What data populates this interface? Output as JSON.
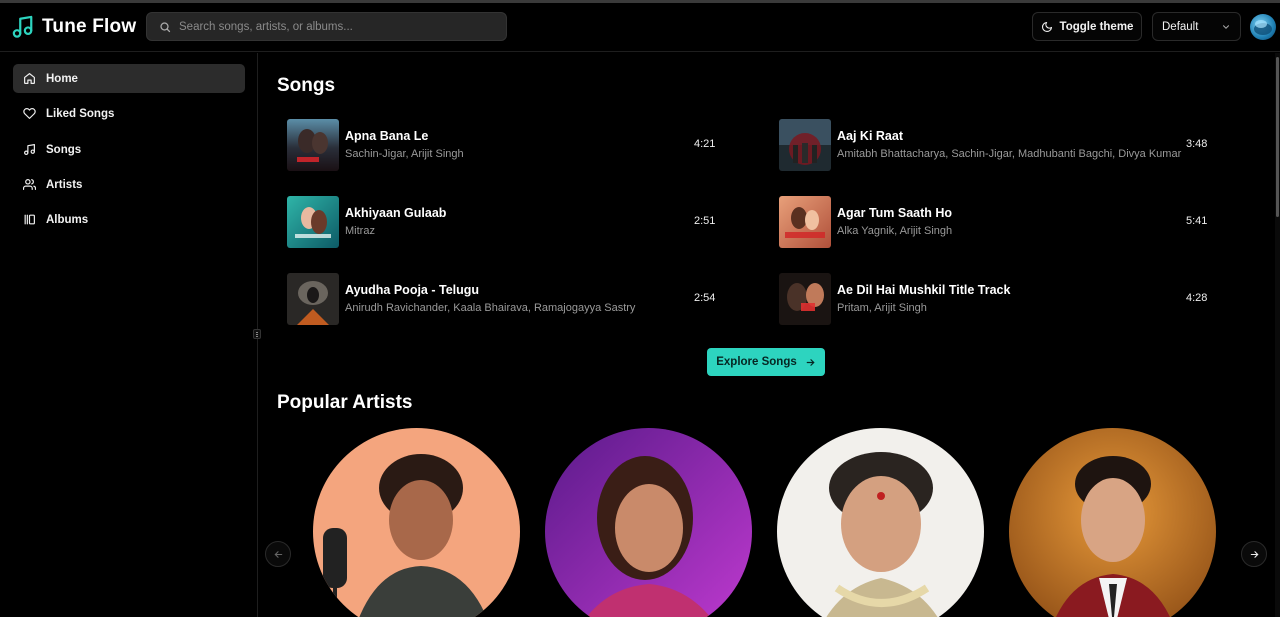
{
  "app": {
    "name": "Tune Flow",
    "accent": "#2dd4bf"
  },
  "header": {
    "search_placeholder": "Search songs, artists, or albums...",
    "toggle_theme_label": "Toggle theme",
    "theme_select_value": "Default"
  },
  "sidebar": {
    "items": [
      {
        "label": "Home",
        "icon": "home-icon",
        "active": true
      },
      {
        "label": "Liked Songs",
        "icon": "heart-icon",
        "active": false
      },
      {
        "label": "Songs",
        "icon": "music-note-icon",
        "active": false
      },
      {
        "label": "Artists",
        "icon": "users-icon",
        "active": false
      },
      {
        "label": "Albums",
        "icon": "library-icon",
        "active": false
      }
    ]
  },
  "songs_section": {
    "title": "Songs",
    "songs": [
      {
        "title": "Apna Bana Le",
        "artist": "Sachin-Jigar, Arijit Singh",
        "duration": "4:21"
      },
      {
        "title": "Aaj Ki Raat",
        "artist": "Amitabh Bhattacharya, Sachin-Jigar, Madhubanti Bagchi, Divya Kumar",
        "duration": "3:48"
      },
      {
        "title": "Akhiyaan Gulaab",
        "artist": "Mitraz",
        "duration": "2:51"
      },
      {
        "title": "Agar Tum Saath Ho",
        "artist": "Alka Yagnik, Arijit Singh",
        "duration": "5:41"
      },
      {
        "title": "Ayudha Pooja - Telugu",
        "artist": "Anirudh Ravichander, Kaala Bhairava, Ramajogayya Sastry",
        "duration": "2:54"
      },
      {
        "title": "Ae Dil Hai Mushkil Title Track",
        "artist": "Pritam, Arijit Singh",
        "duration": "4:28"
      }
    ],
    "explore_label": "Explore Songs"
  },
  "artists_section": {
    "title": "Popular Artists"
  }
}
